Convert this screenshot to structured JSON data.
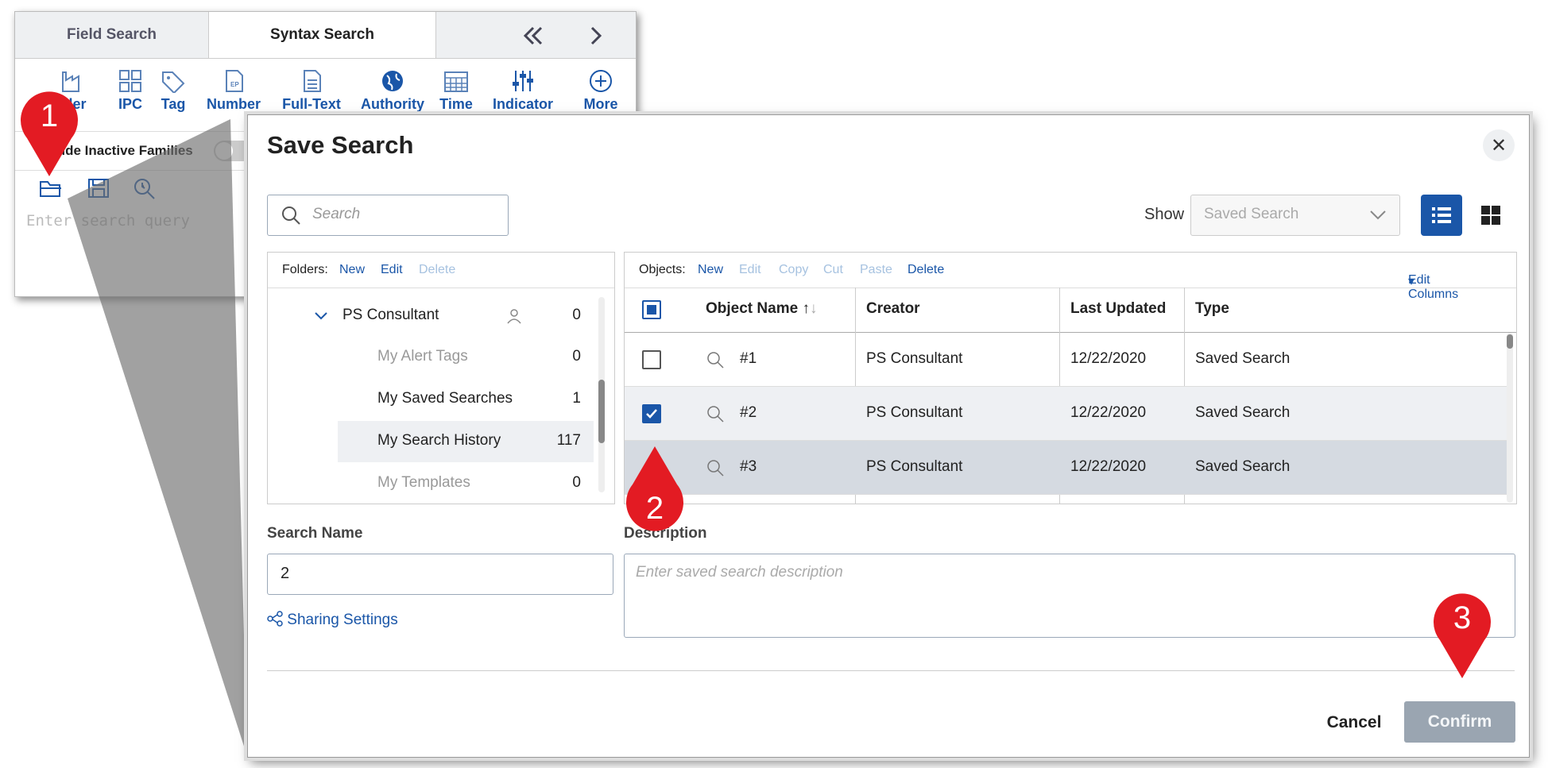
{
  "background_window": {
    "tabs": [
      "Field Search",
      "Syntax Search"
    ],
    "tools": [
      {
        "label": "lder",
        "icon": "factory-icon"
      },
      {
        "label": "IPC",
        "icon": "grid-icon"
      },
      {
        "label": "Tag",
        "icon": "tag-icon"
      },
      {
        "label": "Number",
        "icon": "document-ep-icon"
      },
      {
        "label": "Full-Text",
        "icon": "document-text-icon"
      },
      {
        "label": "Authority",
        "icon": "globe-icon"
      },
      {
        "label": "Time",
        "icon": "calendar-icon"
      },
      {
        "label": "Indicator",
        "icon": "sliders-icon"
      },
      {
        "label": "More",
        "icon": "plus-circle-icon"
      }
    ],
    "inactive_label": "lude Inactive Families",
    "query_placeholder": "Enter search query"
  },
  "modal": {
    "title": "Save Search",
    "search_placeholder": "Search",
    "show_label": "Show",
    "show_value": "Saved Search",
    "folders_header": {
      "label": "Folders:",
      "new": "New",
      "edit": "Edit",
      "delete": "Delete"
    },
    "folders": [
      {
        "name": "PS Consultant",
        "count": "0"
      },
      {
        "name": "My Alert Tags",
        "count": "0"
      },
      {
        "name": "My Saved Searches",
        "count": "1"
      },
      {
        "name": "My Search History",
        "count": "117"
      },
      {
        "name": "My Templates",
        "count": "0"
      }
    ],
    "objects_header": {
      "label": "Objects:",
      "new": "New",
      "edit": "Edit",
      "copy": "Copy",
      "cut": "Cut",
      "paste": "Paste",
      "delete": "Delete",
      "edit_columns": "Edit Columns"
    },
    "columns": [
      "Object Name",
      "Creator",
      "Last Updated",
      "Type"
    ],
    "rows": [
      {
        "name": "#1",
        "creator": "PS Consultant",
        "updated": "12/22/2020",
        "type": "Saved Search",
        "checked": false
      },
      {
        "name": "#2",
        "creator": "PS Consultant",
        "updated": "12/22/2020",
        "type": "Saved Search",
        "checked": true
      },
      {
        "name": "#3",
        "creator": "PS Consultant",
        "updated": "12/22/2020",
        "type": "Saved Search",
        "checked": false
      }
    ],
    "search_name_label": "Search Name",
    "search_name_value": "2",
    "description_label": "Description",
    "description_placeholder": "Enter saved search description",
    "sharing_label": "Sharing Settings",
    "cancel_label": "Cancel",
    "confirm_label": "Confirm"
  },
  "pins": [
    "1",
    "2",
    "3"
  ],
  "colors": {
    "accent": "#1a56a8",
    "pin": "#e31b23",
    "confirm_disabled": "#9aa5b1",
    "selected_row": "#d5dae1",
    "hover_row": "#eef0f3"
  }
}
